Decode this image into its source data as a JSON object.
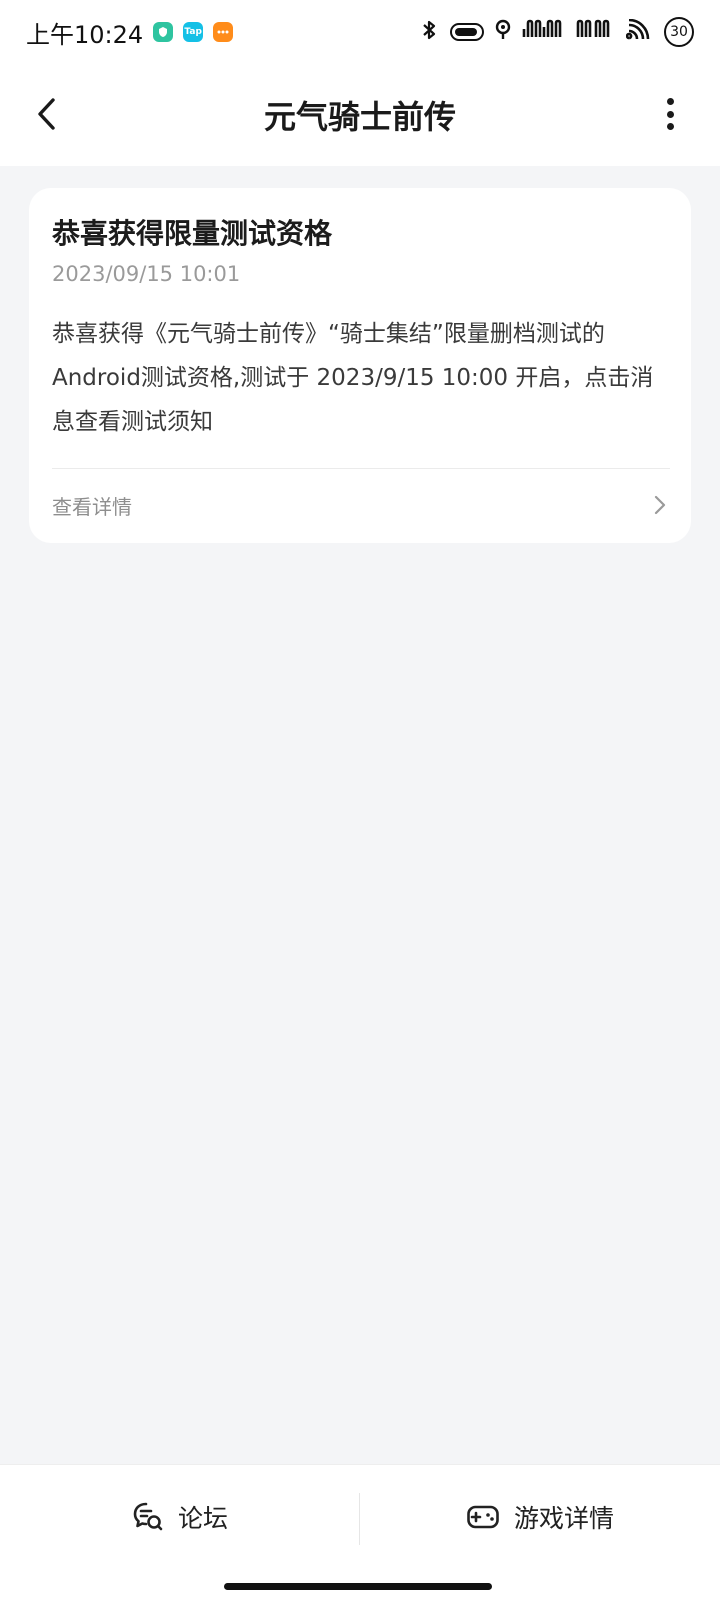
{
  "status_bar": {
    "time": "上午10:24",
    "notif_tap": "Tap",
    "battery_level": "30"
  },
  "nav": {
    "title": "元气骑士前传"
  },
  "message": {
    "title": "恭喜获得限量测试资格",
    "time": "2023/09/15 10:01",
    "body": "恭喜获得《元气骑士前传》“骑士集结”限量删档测试的Android测试资格,测试于 2023/9/15 10:00 开启，点击消息查看测试须知",
    "link_label": "查看详情"
  },
  "bottom_bar": {
    "forum_label": "论坛",
    "game_details_label": "游戏详情"
  },
  "colors": {
    "background": "#f4f5f7",
    "card": "#ffffff",
    "text_primary": "#1c1c1c",
    "text_secondary": "#9a9a9a",
    "notif_green": "#2ec4a0",
    "notif_tap": "#14c0e6",
    "notif_orange": "#ff8c1a"
  }
}
